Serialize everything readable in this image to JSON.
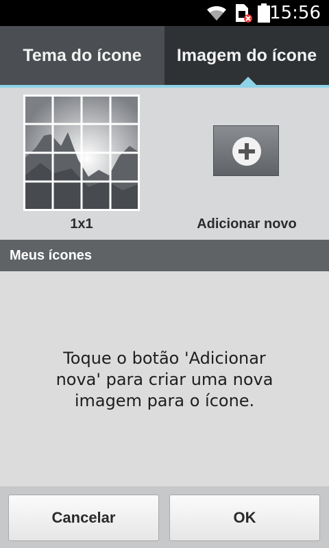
{
  "status_bar": {
    "time": "15:56",
    "icons": [
      "wifi-icon",
      "sim-error-icon",
      "battery-icon"
    ]
  },
  "tabs": [
    {
      "label": "Tema do ícone",
      "selected": false
    },
    {
      "label": "Imagem do ícone",
      "selected": true
    }
  ],
  "icon_grid": {
    "thumbnail_label": "1x1",
    "add_label": "Adicionar novo"
  },
  "my_icons": {
    "header": "Meus ícones",
    "empty_message": "Toque o botão 'Adicionar nova' para criar uma nova imagem para o ícone."
  },
  "buttons": {
    "cancel": "Cancelar",
    "ok": "OK"
  },
  "colors": {
    "accent": "#8fd3e8",
    "tab_bar": "#3a3d40",
    "section_header": "#606366"
  }
}
